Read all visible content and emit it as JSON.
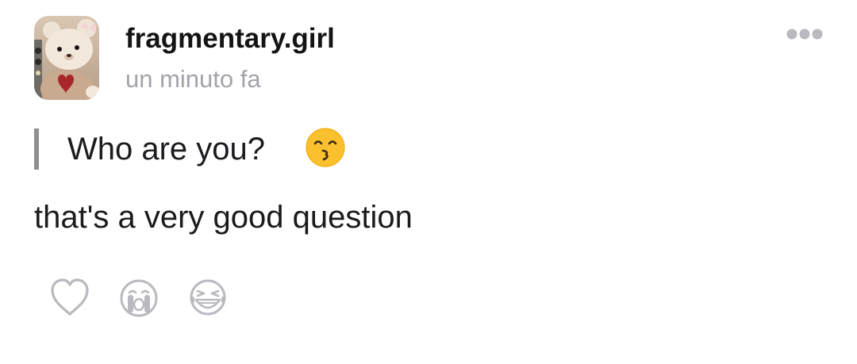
{
  "post": {
    "username": "fragmentary.girl",
    "timestamp": "un minuto fa",
    "quote": {
      "text": "Who are you?",
      "emoji": "kissing-face-emoji"
    },
    "body": "that's a very good question"
  },
  "actions": {
    "more_icon": "ellipsis-icon",
    "reactions": [
      {
        "icon": "heart-outline-icon"
      },
      {
        "icon": "crying-face-icon"
      },
      {
        "icon": "laughing-tears-face-icon"
      }
    ]
  },
  "colors": {
    "text_primary": "#141416",
    "text_secondary": "#a3a3ab",
    "quote_bar": "#8e8e93",
    "icon_gray": "#b9b9bf",
    "emoji_yellow": "#fbc02d"
  }
}
